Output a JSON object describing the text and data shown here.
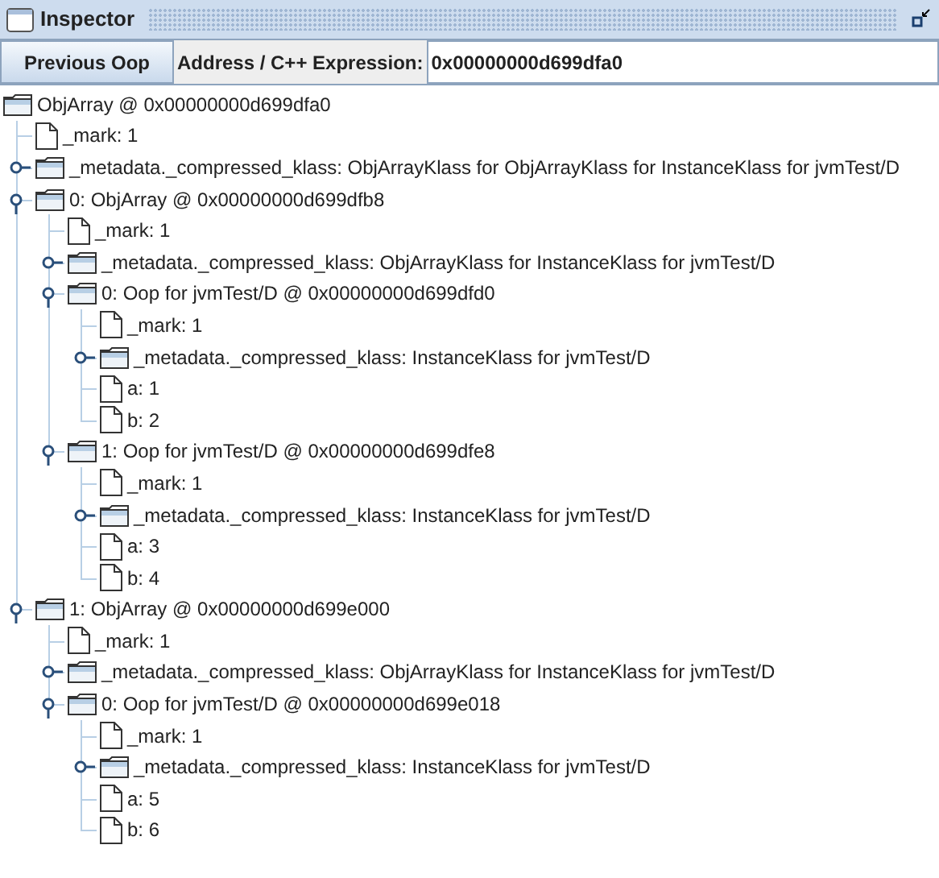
{
  "window": {
    "title": "Inspector"
  },
  "toolbar": {
    "button": "Previous Oop",
    "address_label": "Address / C++ Expression:",
    "address_value": "0x00000000d699dfa0"
  },
  "tree": [
    {
      "kind": "folder",
      "label": "ObjArray @ 0x00000000d699dfa0",
      "children": [
        {
          "kind": "leaf",
          "label": "_mark: 1"
        },
        {
          "kind": "folder",
          "label": "_metadata._compressed_klass: ObjArrayKlass for ObjArrayKlass for InstanceKlass for jvmTest/D",
          "expanded": false
        },
        {
          "kind": "folder",
          "label": "0: ObjArray @ 0x00000000d699dfb8",
          "expanded": true,
          "children": [
            {
              "kind": "leaf",
              "label": "_mark: 1"
            },
            {
              "kind": "folder",
              "label": "_metadata._compressed_klass: ObjArrayKlass for InstanceKlass for jvmTest/D",
              "expanded": false
            },
            {
              "kind": "folder",
              "label": "0: Oop for jvmTest/D @ 0x00000000d699dfd0",
              "expanded": true,
              "children": [
                {
                  "kind": "leaf",
                  "label": "_mark: 1"
                },
                {
                  "kind": "folder",
                  "label": "_metadata._compressed_klass: InstanceKlass for jvmTest/D",
                  "expanded": false
                },
                {
                  "kind": "leaf",
                  "label": "a: 1"
                },
                {
                  "kind": "leaf",
                  "label": "b: 2"
                }
              ]
            },
            {
              "kind": "folder",
              "label": "1: Oop for jvmTest/D @ 0x00000000d699dfe8",
              "expanded": true,
              "children": [
                {
                  "kind": "leaf",
                  "label": "_mark: 1"
                },
                {
                  "kind": "folder",
                  "label": "_metadata._compressed_klass: InstanceKlass for jvmTest/D",
                  "expanded": false
                },
                {
                  "kind": "leaf",
                  "label": "a: 3"
                },
                {
                  "kind": "leaf",
                  "label": "b: 4"
                }
              ]
            }
          ]
        },
        {
          "kind": "folder",
          "label": "1: ObjArray @ 0x00000000d699e000",
          "expanded": true,
          "children": [
            {
              "kind": "leaf",
              "label": "_mark: 1"
            },
            {
              "kind": "folder",
              "label": "_metadata._compressed_klass: ObjArrayKlass for InstanceKlass for jvmTest/D",
              "expanded": false
            },
            {
              "kind": "folder",
              "label": "0: Oop for jvmTest/D @ 0x00000000d699e018",
              "expanded": true,
              "children": [
                {
                  "kind": "leaf",
                  "label": "_mark: 1"
                },
                {
                  "kind": "folder",
                  "label": "_metadata._compressed_klass: InstanceKlass for jvmTest/D",
                  "expanded": false
                },
                {
                  "kind": "leaf",
                  "label": "a: 5"
                },
                {
                  "kind": "leaf",
                  "label": "b: 6"
                }
              ]
            }
          ]
        }
      ]
    }
  ]
}
